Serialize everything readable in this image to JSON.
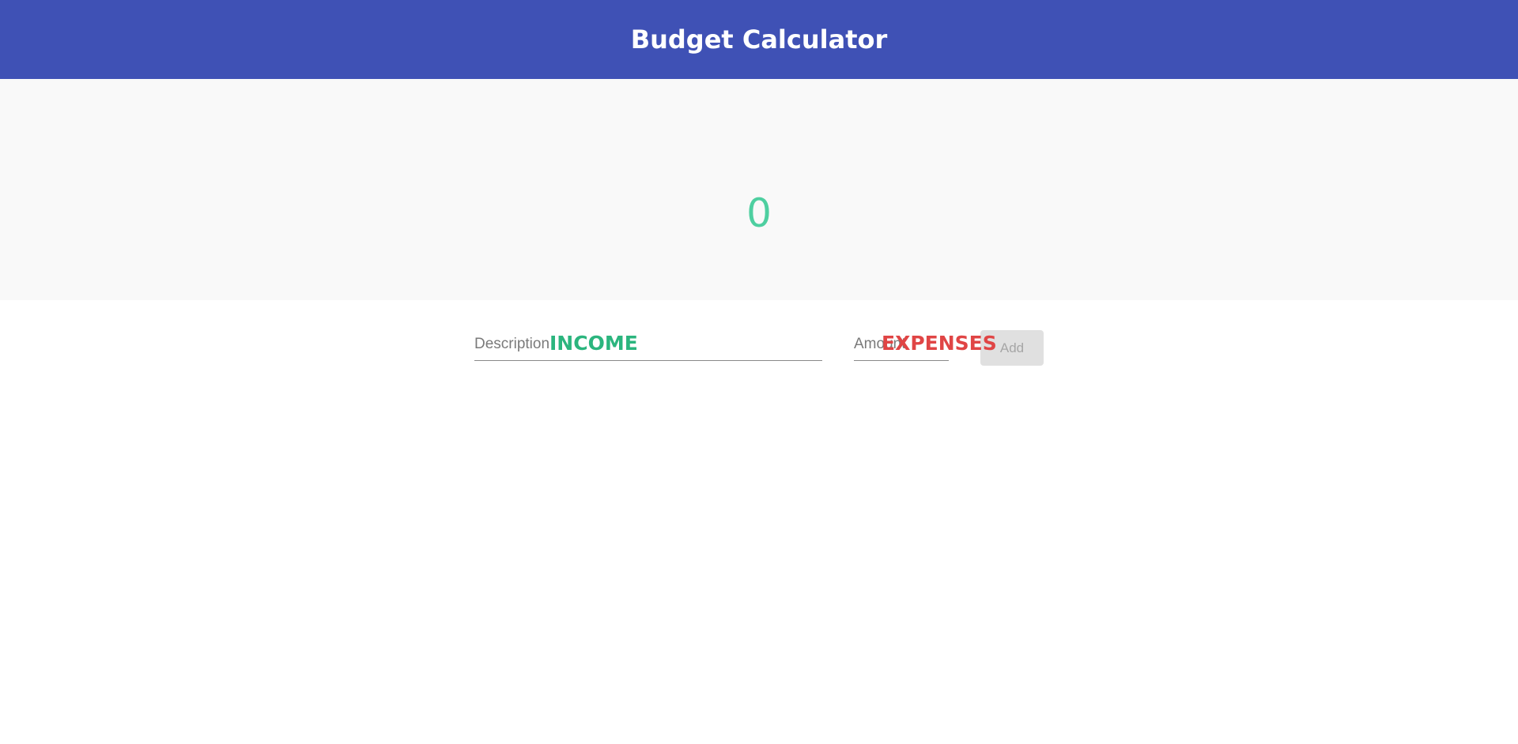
{
  "header": {
    "title": "Budget Calculator"
  },
  "summary": {
    "balance": "0"
  },
  "form": {
    "description_placeholder": "Description",
    "amount_placeholder": "Amount",
    "add_label": "Add"
  },
  "lists": {
    "income_label": "INCOME",
    "expenses_label": "EXPENSES"
  },
  "colors": {
    "header": "#3f51b5",
    "balance": "#4ecfa0",
    "income": "#2bb57e",
    "expenses": "#e04545",
    "button_disabled": "#e0e0e0"
  }
}
